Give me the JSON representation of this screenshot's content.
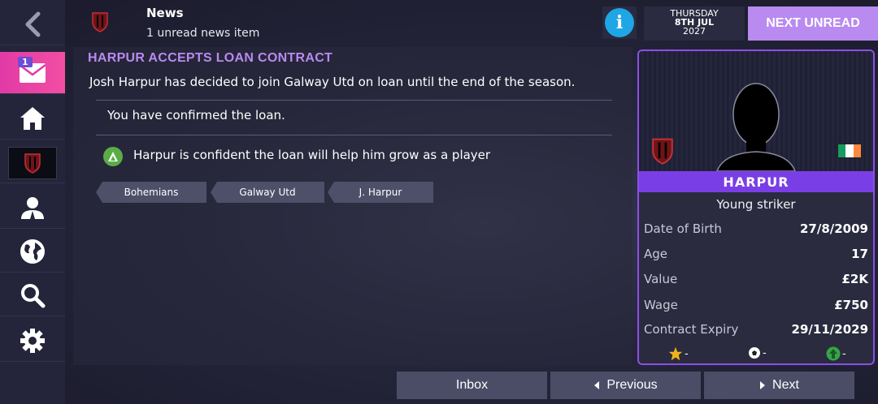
{
  "header": {
    "title": "News",
    "subtitle": "1 unread news item",
    "info_icon": "i",
    "date": {
      "day": "THURSDAY",
      "date": "8TH JUL",
      "year": "2027"
    },
    "next_unread_label": "NEXT UNREAD"
  },
  "sidebar": {
    "inbox_badge": "1",
    "items": [
      "back-icon",
      "inbox-icon",
      "home-icon",
      "club-crest-icon",
      "manager-icon",
      "globe-icon",
      "search-icon",
      "settings-icon"
    ]
  },
  "article": {
    "headline": "HARPUR ACCEPTS LOAN CONTRACT",
    "body": "Josh Harpur has decided to join Galway Utd on loan until the end of the season.",
    "confirmation": "You have confirmed the loan.",
    "morale_text": "Harpur is confident the loan will help him grow as a player",
    "tags": [
      "Bohemians",
      "Galway Utd",
      "J. Harpur"
    ]
  },
  "player_card": {
    "name": "HARPUR",
    "role": "Young striker",
    "rows": [
      {
        "label": "Date of Birth",
        "value": "27/8/2009"
      },
      {
        "label": "Age",
        "value": "17"
      },
      {
        "label": "Value",
        "value": "£2K"
      },
      {
        "label": "Wage",
        "value": "£750"
      },
      {
        "label": "Contract Expiry",
        "value": "29/11/2029"
      }
    ],
    "icons": [
      {
        "name": "star-icon",
        "value": "-"
      },
      {
        "name": "ball-icon",
        "value": "-"
      },
      {
        "name": "growth-arrow-icon",
        "value": "-"
      }
    ]
  },
  "footer": {
    "inbox_label": "Inbox",
    "previous_label": "Previous",
    "next_label": "Next"
  },
  "colors": {
    "accent_purple": "#b98af0",
    "name_bar": "#7a3ee6",
    "active_sidebar": "#e23aa6",
    "info_blue": "#1ea6e6",
    "morale_green": "#5aad45"
  }
}
